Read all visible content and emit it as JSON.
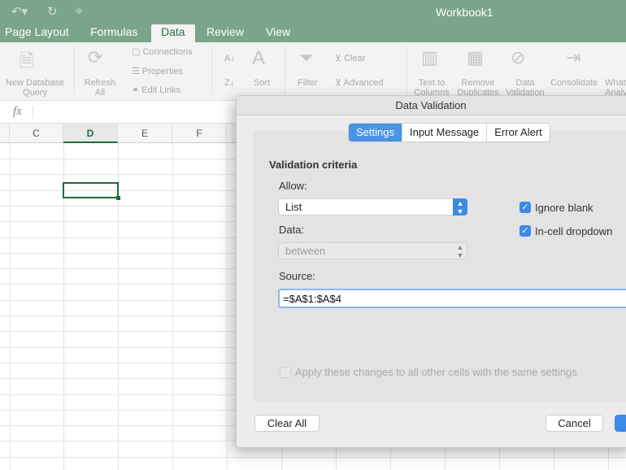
{
  "titlebar": {
    "title": "Workbook1",
    "undo_icon": "undo-icon",
    "redo_icon": "redo-icon",
    "customize_icon": "customize-icon"
  },
  "tabs": [
    {
      "label": "Page Layout"
    },
    {
      "label": "Formulas"
    },
    {
      "label": "Data",
      "active": true
    },
    {
      "label": "Review"
    },
    {
      "label": "View"
    }
  ],
  "ribbon": {
    "new_db_query": "New Database Query",
    "refresh_all": "Refresh All",
    "connections": "Connections",
    "properties": "Properties",
    "edit_links": "Edit Links",
    "sort": "Sort",
    "filter": "Filter",
    "clear": "Clear",
    "advanced": "Advanced",
    "text_to_columns": "Text to Columns",
    "remove_duplicates": "Remove Duplicates",
    "data_validation": "Data Validation",
    "consolidate": "Consolidate",
    "what_if": "What-If Analysis"
  },
  "formula_bar": {
    "fx": "fx",
    "value": ""
  },
  "columns": [
    "C",
    "D",
    "E",
    "F"
  ],
  "selected_column": "D",
  "dialog": {
    "title": "Data Validation",
    "tabs": [
      {
        "label": "Settings",
        "active": true
      },
      {
        "label": "Input Message"
      },
      {
        "label": "Error Alert"
      }
    ],
    "section": "Validation criteria",
    "allow_label": "Allow:",
    "allow_value": "List",
    "data_label": "Data:",
    "data_value": "between",
    "ignore_blank": {
      "label": "Ignore blank",
      "checked": true
    },
    "in_cell_dropdown": {
      "label": "In-cell dropdown",
      "checked": true
    },
    "source_label": "Source:",
    "source_value": "=$A$1:$A$4",
    "apply_all": {
      "label": "Apply these changes to all other cells with the same settings",
      "checked": false,
      "enabled": false
    },
    "clear_all": "Clear All",
    "cancel": "Cancel",
    "accent": "#3d8ae5"
  }
}
